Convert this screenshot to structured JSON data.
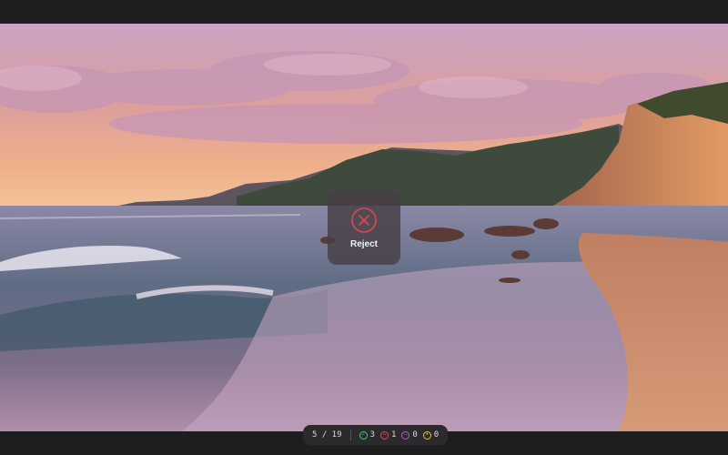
{
  "overlay": {
    "label": "Reject",
    "icon": "x-circle-icon",
    "accent": "#e0474c"
  },
  "status": {
    "counter": "5 / 19",
    "items": [
      {
        "name": "accepted",
        "icon": "check-circle-icon",
        "count": "3",
        "color": "#4cc85a"
      },
      {
        "name": "rejected",
        "icon": "x-circle-icon",
        "count": "1",
        "color": "#e0474c"
      },
      {
        "name": "skipped",
        "icon": "dash-circle-icon",
        "count": "0",
        "color": "#b45ad8"
      },
      {
        "name": "flagged",
        "icon": "star-circle-icon",
        "count": "0",
        "color": "#e6c13a"
      }
    ]
  }
}
